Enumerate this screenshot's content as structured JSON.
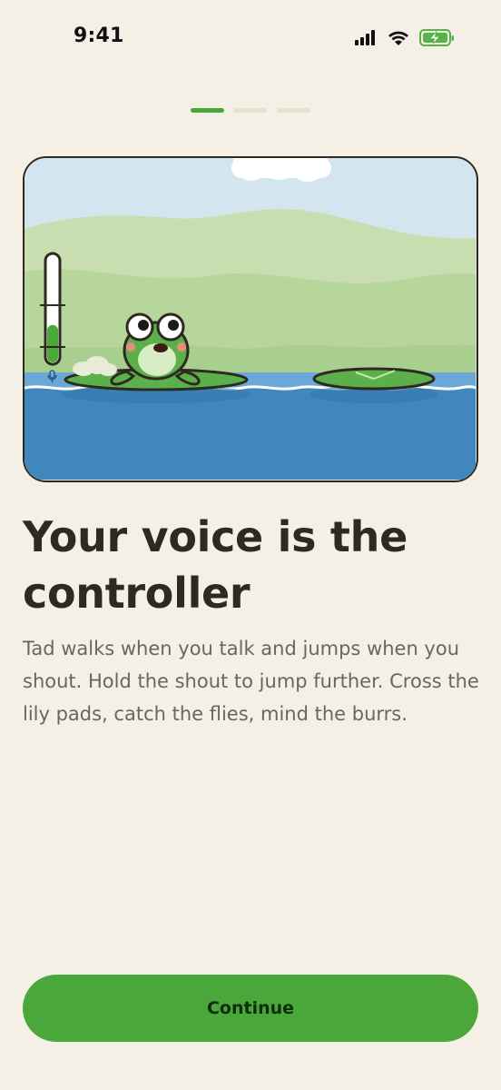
{
  "status_bar": {
    "time": "9:41",
    "icons": [
      "cellular-signal-icon",
      "wifi-icon",
      "battery-charging-icon"
    ]
  },
  "onboarding": {
    "page_count": 3,
    "current_page": 1
  },
  "illustration": {
    "mic_level_fraction": 0.35
  },
  "headline": "Your voice is the controller",
  "body": "Tad walks when you talk and jumps when you shout. Hold the shout to jump further. Cross the lily pads, catch the flies, mind the burrs.",
  "continue_label": "Continue",
  "colors": {
    "background": "#f5f0e6",
    "accent": "#4aa83a",
    "heading": "#2e2a22",
    "body": "#6b665c",
    "water": "#3f87bd"
  }
}
